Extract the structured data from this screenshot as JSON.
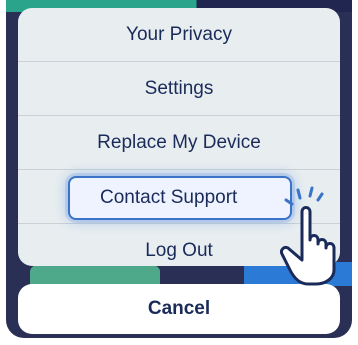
{
  "menu": {
    "items": [
      {
        "label": "Your Privacy"
      },
      {
        "label": "Settings"
      },
      {
        "label": "Replace My Device"
      },
      {
        "label": "Contact Support"
      },
      {
        "label": "Log Out"
      }
    ],
    "cancel_label": "Cancel"
  },
  "colors": {
    "sheet_bg": "#e8eef0",
    "text": "#1a2b5a",
    "highlight_border": "#3a73c8",
    "backdrop": "#2a2f55"
  },
  "icons": {
    "cursor": "pointing-hand-icon"
  }
}
